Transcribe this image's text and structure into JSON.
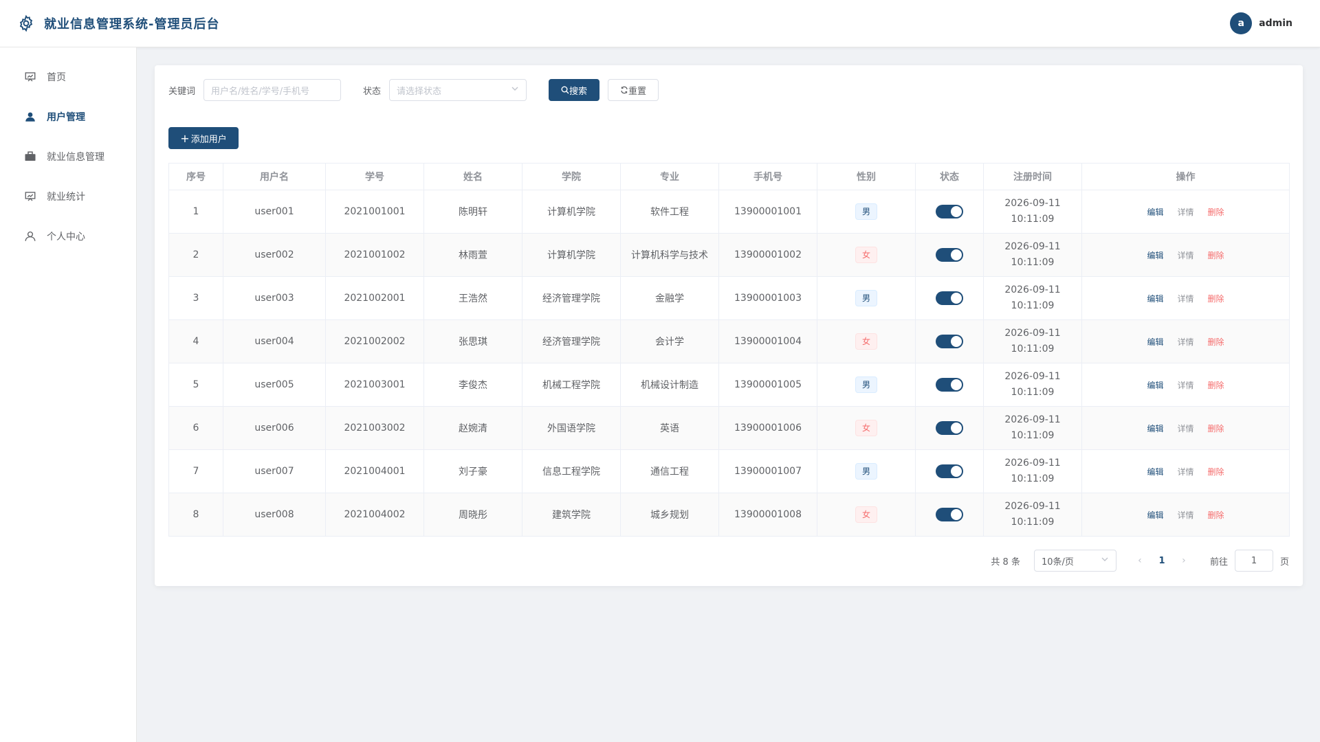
{
  "app": {
    "title": "就业信息管理系统-管理员后台"
  },
  "user": {
    "avatar_letter": "a",
    "name": "admin"
  },
  "sidebar": {
    "items": [
      {
        "label": "首页",
        "icon": "chart-board-icon"
      },
      {
        "label": "用户管理",
        "icon": "user-icon"
      },
      {
        "label": "就业信息管理",
        "icon": "briefcase-icon"
      },
      {
        "label": "就业统计",
        "icon": "chart-board-icon"
      },
      {
        "label": "个人中心",
        "icon": "user-outline-icon"
      }
    ],
    "active_index": 1
  },
  "filters": {
    "keyword_label": "关键词",
    "keyword_placeholder": "用户名/姓名/学号/手机号",
    "status_label": "状态",
    "status_placeholder": "请选择状态",
    "search_label": "搜索",
    "reset_label": "重置"
  },
  "actions": {
    "add_user_label": "添加用户"
  },
  "table": {
    "columns": [
      "序号",
      "用户名",
      "学号",
      "姓名",
      "学院",
      "专业",
      "手机号",
      "性别",
      "状态",
      "注册时间",
      "操作"
    ],
    "rows": [
      {
        "idx": "1",
        "username": "user001",
        "student_id": "2021001001",
        "name": "陈明轩",
        "college": "计算机学院",
        "major": "软件工程",
        "phone": "13900001001",
        "gender": "男",
        "enabled": true,
        "reg_date": "2026-09-11",
        "reg_time": "10:11:09"
      },
      {
        "idx": "2",
        "username": "user002",
        "student_id": "2021001002",
        "name": "林雨萱",
        "college": "计算机学院",
        "major": "计算机科学与技术",
        "phone": "13900001002",
        "gender": "女",
        "enabled": true,
        "reg_date": "2026-09-11",
        "reg_time": "10:11:09"
      },
      {
        "idx": "3",
        "username": "user003",
        "student_id": "2021002001",
        "name": "王浩然",
        "college": "经济管理学院",
        "major": "金融学",
        "phone": "13900001003",
        "gender": "男",
        "enabled": true,
        "reg_date": "2026-09-11",
        "reg_time": "10:11:09"
      },
      {
        "idx": "4",
        "username": "user004",
        "student_id": "2021002002",
        "name": "张思琪",
        "college": "经济管理学院",
        "major": "会计学",
        "phone": "13900001004",
        "gender": "女",
        "enabled": true,
        "reg_date": "2026-09-11",
        "reg_time": "10:11:09"
      },
      {
        "idx": "5",
        "username": "user005",
        "student_id": "2021003001",
        "name": "李俊杰",
        "college": "机械工程学院",
        "major": "机械设计制造",
        "phone": "13900001005",
        "gender": "男",
        "enabled": true,
        "reg_date": "2026-09-11",
        "reg_time": "10:11:09"
      },
      {
        "idx": "6",
        "username": "user006",
        "student_id": "2021003002",
        "name": "赵婉清",
        "college": "外国语学院",
        "major": "英语",
        "phone": "13900001006",
        "gender": "女",
        "enabled": true,
        "reg_date": "2026-09-11",
        "reg_time": "10:11:09"
      },
      {
        "idx": "7",
        "username": "user007",
        "student_id": "2021004001",
        "name": "刘子豪",
        "college": "信息工程学院",
        "major": "通信工程",
        "phone": "13900001007",
        "gender": "男",
        "enabled": true,
        "reg_date": "2026-09-11",
        "reg_time": "10:11:09"
      },
      {
        "idx": "8",
        "username": "user008",
        "student_id": "2021004002",
        "name": "周晓彤",
        "college": "建筑学院",
        "major": "城乡规划",
        "phone": "13900001008",
        "gender": "女",
        "enabled": true,
        "reg_date": "2026-09-11",
        "reg_time": "10:11:09"
      }
    ],
    "op_labels": {
      "edit": "编辑",
      "detail": "详情",
      "delete": "删除"
    }
  },
  "pagination": {
    "total_text": "共 8 条",
    "page_size": "10条/页",
    "current_page": "1",
    "goto_prefix": "前往",
    "goto_value": "1",
    "goto_suffix": "页"
  },
  "colors": {
    "primary": "#1f4e79",
    "danger": "#f56c6c",
    "background": "#f0f2f5"
  }
}
